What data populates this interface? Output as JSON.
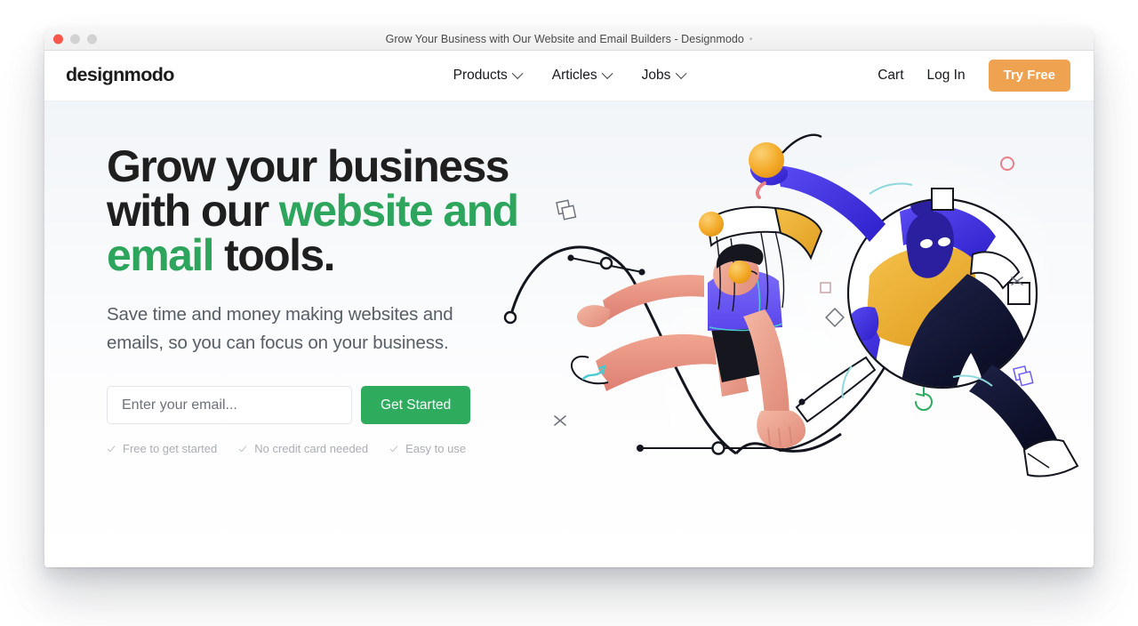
{
  "window": {
    "title": "Grow Your Business with Our Website and Email Builders - Designmodo",
    "favicon_glyph": "•",
    "traffic_lights": [
      "close-red",
      "minimize-gray",
      "zoom-gray"
    ]
  },
  "header": {
    "logo": "designmodo",
    "nav": [
      {
        "label": "Products",
        "icon": "chevron-down-icon"
      },
      {
        "label": "Articles",
        "icon": "chevron-down-icon"
      },
      {
        "label": "Jobs",
        "icon": "chevron-down-icon"
      }
    ],
    "cart_label": "Cart",
    "login_label": "Log In",
    "cta_label": "Try Free",
    "cta_color": "#EFA351"
  },
  "hero": {
    "headline": {
      "part1": "Grow your business with our ",
      "accent": "website and email",
      "part2": " tools."
    },
    "subhead": "Save time and money making websites and emails, so you can focus on your business.",
    "email_placeholder": "Enter your email...",
    "email_value": "",
    "submit_label": "Get Started",
    "submit_color": "#2EAB5D",
    "accent_color": "#2EA55C",
    "features": [
      {
        "icon": "check-icon",
        "label": "Free to get started"
      },
      {
        "icon": "check-icon",
        "label": "No credit card needed"
      },
      {
        "icon": "check-icon",
        "label": "Easy to use"
      }
    ]
  },
  "illustration": {
    "name": "designers-with-vector-tools-illustration",
    "decorations": [
      "bezier-curve-handles",
      "yellow-sphere",
      "circle-outline-icon",
      "plus-icon",
      "copy-layers-icon",
      "rotate-refresh-icon",
      "diamond-icon",
      "square-outline-icon",
      "selection-handle-square"
    ],
    "palette": {
      "blue": "#4338f0",
      "navy": "#111436",
      "yellow": "#f0b43c",
      "orange_sphere": "#f4a72a",
      "skin": "#e9907e",
      "purple": "#6b5cf0",
      "teal": "#49c9d0",
      "green": "#2eab5d",
      "pink": "#e8808a"
    }
  }
}
